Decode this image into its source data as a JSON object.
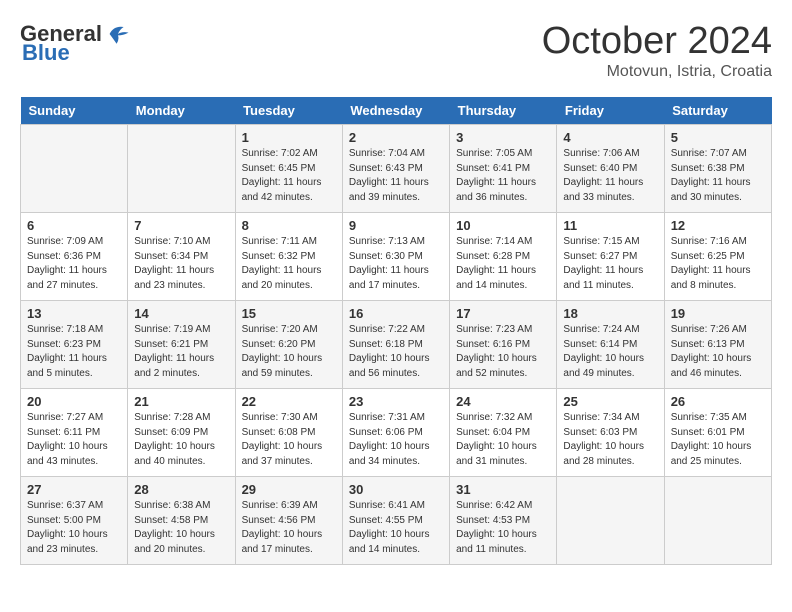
{
  "logo": {
    "general": "General",
    "blue": "Blue"
  },
  "header": {
    "month": "October 2024",
    "location": "Motovun, Istria, Croatia"
  },
  "weekdays": [
    "Sunday",
    "Monday",
    "Tuesday",
    "Wednesday",
    "Thursday",
    "Friday",
    "Saturday"
  ],
  "weeks": [
    [
      {
        "day": "",
        "info": ""
      },
      {
        "day": "",
        "info": ""
      },
      {
        "day": "1",
        "info": "Sunrise: 7:02 AM\nSunset: 6:45 PM\nDaylight: 11 hours and 42 minutes."
      },
      {
        "day": "2",
        "info": "Sunrise: 7:04 AM\nSunset: 6:43 PM\nDaylight: 11 hours and 39 minutes."
      },
      {
        "day": "3",
        "info": "Sunrise: 7:05 AM\nSunset: 6:41 PM\nDaylight: 11 hours and 36 minutes."
      },
      {
        "day": "4",
        "info": "Sunrise: 7:06 AM\nSunset: 6:40 PM\nDaylight: 11 hours and 33 minutes."
      },
      {
        "day": "5",
        "info": "Sunrise: 7:07 AM\nSunset: 6:38 PM\nDaylight: 11 hours and 30 minutes."
      }
    ],
    [
      {
        "day": "6",
        "info": "Sunrise: 7:09 AM\nSunset: 6:36 PM\nDaylight: 11 hours and 27 minutes."
      },
      {
        "day": "7",
        "info": "Sunrise: 7:10 AM\nSunset: 6:34 PM\nDaylight: 11 hours and 23 minutes."
      },
      {
        "day": "8",
        "info": "Sunrise: 7:11 AM\nSunset: 6:32 PM\nDaylight: 11 hours and 20 minutes."
      },
      {
        "day": "9",
        "info": "Sunrise: 7:13 AM\nSunset: 6:30 PM\nDaylight: 11 hours and 17 minutes."
      },
      {
        "day": "10",
        "info": "Sunrise: 7:14 AM\nSunset: 6:28 PM\nDaylight: 11 hours and 14 minutes."
      },
      {
        "day": "11",
        "info": "Sunrise: 7:15 AM\nSunset: 6:27 PM\nDaylight: 11 hours and 11 minutes."
      },
      {
        "day": "12",
        "info": "Sunrise: 7:16 AM\nSunset: 6:25 PM\nDaylight: 11 hours and 8 minutes."
      }
    ],
    [
      {
        "day": "13",
        "info": "Sunrise: 7:18 AM\nSunset: 6:23 PM\nDaylight: 11 hours and 5 minutes."
      },
      {
        "day": "14",
        "info": "Sunrise: 7:19 AM\nSunset: 6:21 PM\nDaylight: 11 hours and 2 minutes."
      },
      {
        "day": "15",
        "info": "Sunrise: 7:20 AM\nSunset: 6:20 PM\nDaylight: 10 hours and 59 minutes."
      },
      {
        "day": "16",
        "info": "Sunrise: 7:22 AM\nSunset: 6:18 PM\nDaylight: 10 hours and 56 minutes."
      },
      {
        "day": "17",
        "info": "Sunrise: 7:23 AM\nSunset: 6:16 PM\nDaylight: 10 hours and 52 minutes."
      },
      {
        "day": "18",
        "info": "Sunrise: 7:24 AM\nSunset: 6:14 PM\nDaylight: 10 hours and 49 minutes."
      },
      {
        "day": "19",
        "info": "Sunrise: 7:26 AM\nSunset: 6:13 PM\nDaylight: 10 hours and 46 minutes."
      }
    ],
    [
      {
        "day": "20",
        "info": "Sunrise: 7:27 AM\nSunset: 6:11 PM\nDaylight: 10 hours and 43 minutes."
      },
      {
        "day": "21",
        "info": "Sunrise: 7:28 AM\nSunset: 6:09 PM\nDaylight: 10 hours and 40 minutes."
      },
      {
        "day": "22",
        "info": "Sunrise: 7:30 AM\nSunset: 6:08 PM\nDaylight: 10 hours and 37 minutes."
      },
      {
        "day": "23",
        "info": "Sunrise: 7:31 AM\nSunset: 6:06 PM\nDaylight: 10 hours and 34 minutes."
      },
      {
        "day": "24",
        "info": "Sunrise: 7:32 AM\nSunset: 6:04 PM\nDaylight: 10 hours and 31 minutes."
      },
      {
        "day": "25",
        "info": "Sunrise: 7:34 AM\nSunset: 6:03 PM\nDaylight: 10 hours and 28 minutes."
      },
      {
        "day": "26",
        "info": "Sunrise: 7:35 AM\nSunset: 6:01 PM\nDaylight: 10 hours and 25 minutes."
      }
    ],
    [
      {
        "day": "27",
        "info": "Sunrise: 6:37 AM\nSunset: 5:00 PM\nDaylight: 10 hours and 23 minutes."
      },
      {
        "day": "28",
        "info": "Sunrise: 6:38 AM\nSunset: 4:58 PM\nDaylight: 10 hours and 20 minutes."
      },
      {
        "day": "29",
        "info": "Sunrise: 6:39 AM\nSunset: 4:56 PM\nDaylight: 10 hours and 17 minutes."
      },
      {
        "day": "30",
        "info": "Sunrise: 6:41 AM\nSunset: 4:55 PM\nDaylight: 10 hours and 14 minutes."
      },
      {
        "day": "31",
        "info": "Sunrise: 6:42 AM\nSunset: 4:53 PM\nDaylight: 10 hours and 11 minutes."
      },
      {
        "day": "",
        "info": ""
      },
      {
        "day": "",
        "info": ""
      }
    ]
  ]
}
